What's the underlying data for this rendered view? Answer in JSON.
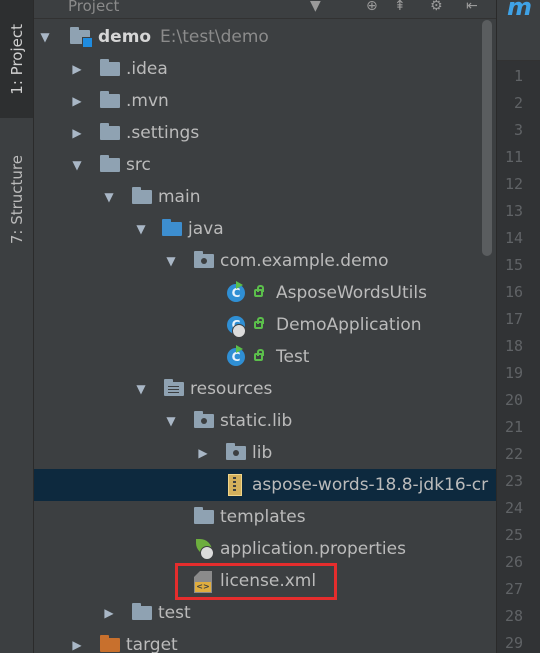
{
  "sidebar": {
    "project_tab": "1: Project",
    "structure_tab": "7: Structure"
  },
  "panel": {
    "title": "Project",
    "icons": [
      "dropdown-icon",
      "locate-icon",
      "collapse-icon",
      "gear-icon",
      "hide-icon"
    ]
  },
  "tree": {
    "root_name": "demo",
    "root_path": "E:\\test\\demo",
    "idea": ".idea",
    "mvn": ".mvn",
    "settings": ".settings",
    "src": "src",
    "main": "main",
    "java": "java",
    "package": "com.example.demo",
    "class1": "AsposeWordsUtils",
    "class2": "DemoApplication",
    "class3": "Test",
    "resources": "resources",
    "static_lib": "static.lib",
    "lib": "lib",
    "jar": "aspose-words-18.8-jdk16-cr",
    "templates": "templates",
    "app_props": "application.properties",
    "license": "license.xml",
    "test": "test",
    "target": "target"
  },
  "editor": {
    "tab_glyph": "m",
    "line_numbers": [
      "1",
      "2",
      "3",
      "11",
      "12",
      "13",
      "14",
      "15",
      "16",
      "17",
      "18",
      "19",
      "20",
      "21",
      "22",
      "23",
      "24",
      "25",
      "26",
      "27",
      "28",
      "29"
    ]
  },
  "colors": {
    "highlight_border": "#e52d2d",
    "selection": "#0d293e",
    "java_folder": "#3d8ecf"
  }
}
